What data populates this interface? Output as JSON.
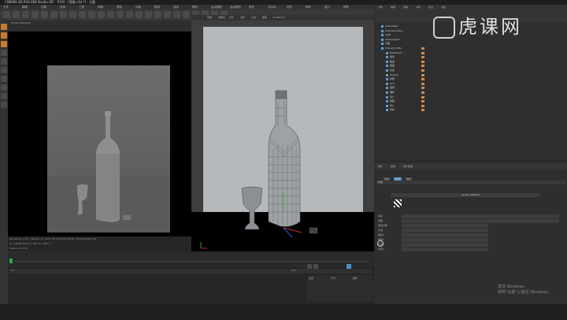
{
  "window": {
    "title": "CINEMA 4D R19.068 Studio (RC - R19) - [酒瓶.c4d *] - 主要"
  },
  "menubar": {
    "items": [
      "文件",
      "编辑",
      "创建",
      "选择",
      "工具",
      "网格",
      "捕捉",
      "动画",
      "模拟",
      "渲染",
      "雕刻",
      "运动跟踪",
      "运动图形",
      "角色",
      "流水线",
      "插件",
      "脚本",
      "窗口",
      "帮助"
    ]
  },
  "viewport_left": {
    "title": "Octane Renderer",
    "info_line1": "Rendering: 0.0% | Ms/sec: 0 | Time: 00:00:00/00:00:00 | Spp/maxspp: 0/0",
    "info_line2": "Tri: 0/256k Mesh: 0 Hair: 0 | GPU: 0",
    "info_line3": "Octane 3.07 R2"
  },
  "viewport_right": {
    "menu": [
      "查看",
      "摄像机",
      "显示",
      "选项",
      "过滤",
      "面板",
      "ProRender"
    ],
    "frame_label": "默认摄像机"
  },
  "timeline": {
    "frame_start": "0 F",
    "frame_end": "90 F",
    "current_frame": "0"
  },
  "object_manager": {
    "menu": [
      "文件",
      "编辑",
      "查看",
      "对象",
      "标签",
      "书签"
    ],
    "objects": [
      {
        "name": "OctaneSky"
      },
      {
        "name": "OctaneCamera"
      },
      {
        "name": "Light"
      },
      {
        "name": "OctaneLight"
      },
      {
        "name": "平面"
      },
      {
        "name": "Overall_bottle"
      },
      {
        "name": "Bottleneck"
      },
      {
        "name": "瓶身"
      },
      {
        "name": "瓶盖"
      },
      {
        "name": "瓶贴"
      },
      {
        "name": "标签"
      },
      {
        "name": "Sphere"
      },
      {
        "name": "材质"
      },
      {
        "name": "Grid"
      },
      {
        "name": "装饰"
      },
      {
        "name": "酒杯"
      },
      {
        "name": "杯1"
      },
      {
        "name": "底座"
      },
      {
        "name": "杯2"
      },
      {
        "name": "杯身"
      }
    ]
  },
  "attribute_manager": {
    "menu": [
      "模式",
      "编辑",
      "用户数据"
    ],
    "tag_title": "Octane Material Tag [Octane Material]",
    "tabs": [
      "基本",
      "标签",
      "坐标"
    ],
    "material_label": "材质",
    "material_value": "Glossy Material",
    "rows": [
      "投射",
      "侧面",
      "混合材质",
      "平铺",
      "偏移U",
      "偏移V",
      "长度U",
      "长度V"
    ]
  },
  "coordinates": {
    "labels": [
      "位置",
      "尺寸",
      "旋转"
    ]
  },
  "watermark": {
    "line1": "激活 Windows",
    "line2": "转到\"设置\"以激活 Windows。"
  },
  "logo": {
    "text": "虎课网"
  },
  "colors": {
    "accent": "#4a8fd0",
    "tag_orange": "#d08a50",
    "frame_bg": "#b5b9bc"
  }
}
